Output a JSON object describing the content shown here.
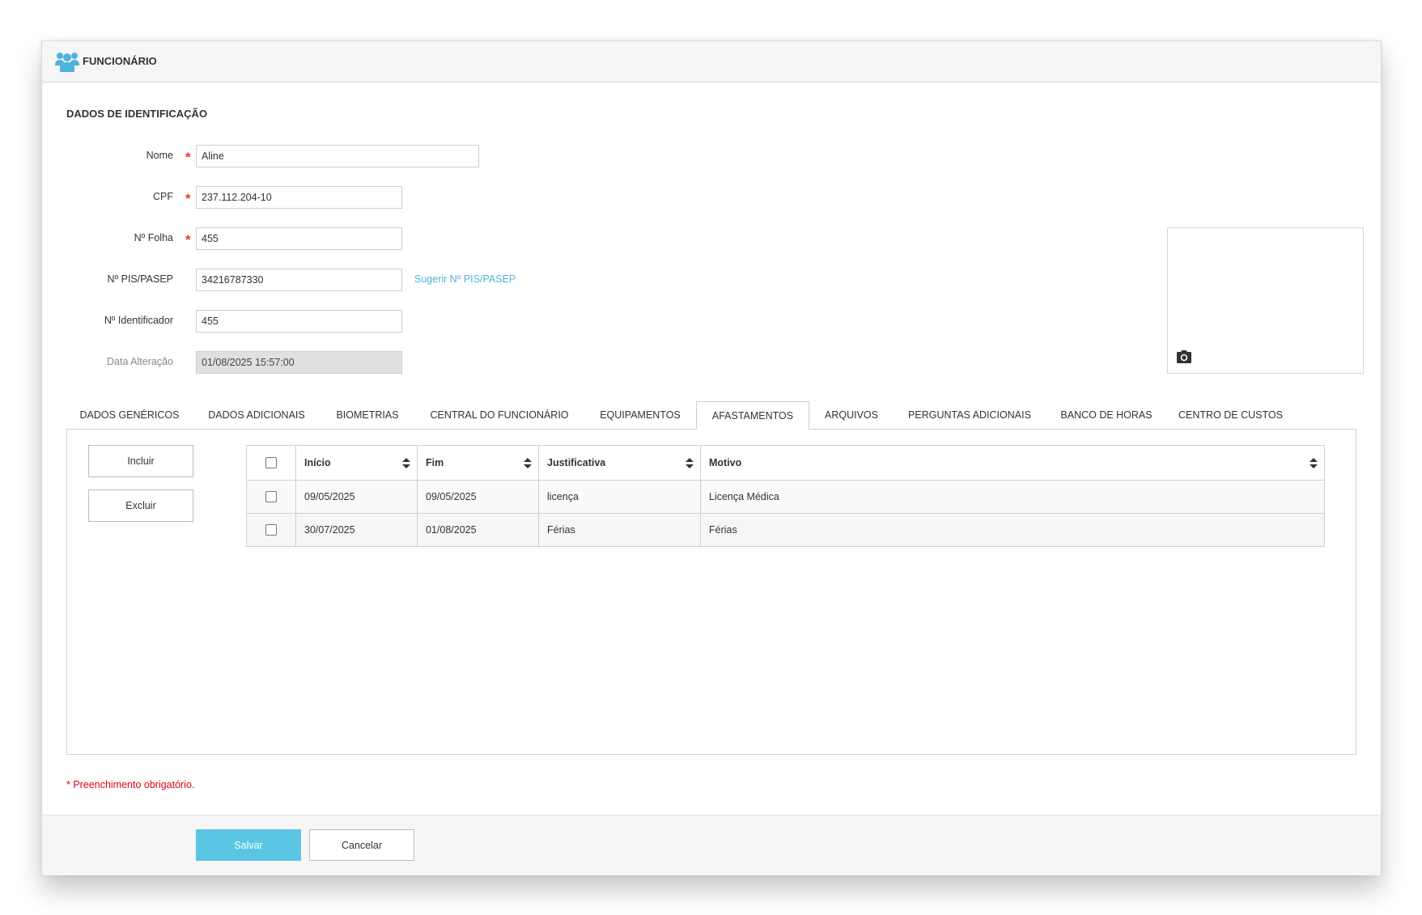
{
  "header": {
    "title": "FUNCIONÁRIO",
    "icon": "users-icon"
  },
  "section": {
    "title": "DADOS DE IDENTIFICAÇÃO"
  },
  "fields": {
    "nome": {
      "label": "Nome",
      "value": "Aline",
      "required": true
    },
    "cpf": {
      "label": "CPF",
      "value": "237.112.204-10",
      "required": true
    },
    "folha": {
      "label": "Nº Folha",
      "value": "455",
      "required": true
    },
    "pis": {
      "label": "Nº PIS/PASEP",
      "value": "34216787330",
      "suggest_link": "Sugerir Nº PIS/PASEP"
    },
    "identificador": {
      "label": "Nº Identificador",
      "value": "455"
    },
    "data_alteracao": {
      "label": "Data Alteração",
      "value": "01/08/2025 15:57:00"
    }
  },
  "required_mark": "*",
  "photo": {
    "icon": "camera-icon"
  },
  "tabs": [
    {
      "label": "DADOS GENÉRICOS"
    },
    {
      "label": "DADOS ADICIONAIS"
    },
    {
      "label": "BIOMETRIAS"
    },
    {
      "label": "CENTRAL DO FUNCIONÁRIO"
    },
    {
      "label": "EQUIPAMENTOS"
    },
    {
      "label": "AFASTAMENTOS",
      "active": true
    },
    {
      "label": "ARQUIVOS"
    },
    {
      "label": "PERGUNTAS ADICIONAIS"
    },
    {
      "label": "BANCO DE HORAS"
    },
    {
      "label": "CENTRO DE CUSTOS"
    }
  ],
  "afastamentos": {
    "include_label": "Incluir",
    "delete_label": "Excluir",
    "columns": [
      "Início",
      "Fim",
      "Justificativa",
      "Motivo"
    ],
    "rows": [
      {
        "inicio": "09/05/2025",
        "fim": "09/05/2025",
        "justificativa": "licença",
        "motivo": "Licença Médica"
      },
      {
        "inicio": "30/07/2025",
        "fim": "01/08/2025",
        "justificativa": "Férias",
        "motivo": "Férias"
      }
    ]
  },
  "required_note": "* Preenchimento obrigatório.",
  "footer": {
    "save_label": "Salvar",
    "cancel_label": "Cancelar"
  },
  "colors": {
    "accent": "#5bc5e4",
    "link": "#4fb3da",
    "required": "#e53935"
  }
}
